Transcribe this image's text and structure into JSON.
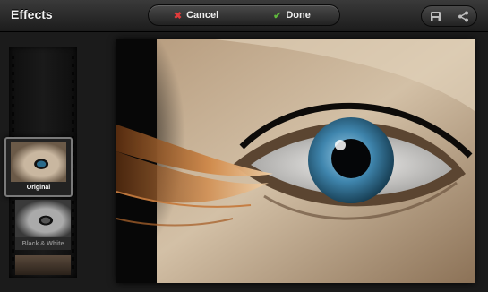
{
  "toolbar": {
    "title": "Effects",
    "cancel_label": "Cancel",
    "done_label": "Done",
    "cancel_icon": "x-icon",
    "done_icon": "check-icon",
    "right_icons": [
      "save-icon",
      "share-icon"
    ]
  },
  "filmstrip": {
    "items": [
      {
        "label": "Original",
        "selected": true
      },
      {
        "label": "Black & White",
        "selected": false
      }
    ]
  },
  "colors": {
    "cancel_icon": "#e03b3b",
    "done_icon": "#5fb83c",
    "iris": "#3f85ad"
  }
}
